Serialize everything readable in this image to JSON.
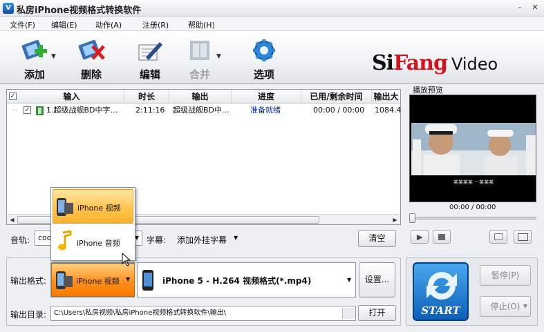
{
  "window": {
    "title": "私房iPhone视频格式转换软件",
    "app_icon": "V"
  },
  "menu": [
    "文件(F)",
    "编辑(E)",
    "动作(A)",
    "注册(R)",
    "帮助(H)"
  ],
  "toolbar": {
    "add": "添加",
    "delete": "删除",
    "edit": "编辑",
    "merge": "合并",
    "options": "选项"
  },
  "brand": {
    "part1": "Si",
    "part2": "Fang",
    "part3": "Video"
  },
  "file_list": {
    "columns": [
      "输入",
      "时长",
      "输出",
      "进度",
      "已用/剩余时间",
      "输出大"
    ],
    "rows": [
      {
        "input": "1.超级战舰BD中字...",
        "duration": "2:11:16",
        "output": "超级战舰BD中...",
        "progress": "准备就绪",
        "elapsed": "00:00 / 00:00",
        "size": "1084.4"
      }
    ]
  },
  "audio": {
    "label": "音轨:",
    "value": "coo"
  },
  "subtitle": {
    "label": "字幕:",
    "value": "添加外挂字幕"
  },
  "clear_button": "清空",
  "popup_menu": {
    "items": [
      "iPhone 视频",
      "iPhone 音频"
    ],
    "selected": 0
  },
  "output": {
    "format_label": "输出格式:",
    "format_category": "iPhone 视频",
    "format_value": "iPhone 5 - H.264 视频格式(*.mp4)",
    "settings_button": "设置...",
    "dir_label": "输出目录:",
    "dir_value": "C:\\Users\\私房视频\\私房iPhone视频格式转换软件\\输出\\",
    "open_button": "打开"
  },
  "preview": {
    "label": "播放预览",
    "time": "00:00 / 00:00",
    "caption": "某某某某 一某某某"
  },
  "controls": {
    "start": "START",
    "pause": "暂停(P)",
    "stop": "停止(O)"
  },
  "colors": {
    "accent_blue": "#0b5fb8",
    "brand_red": "#d3141c",
    "progress_text": "#0a2fd0",
    "orange": "#f57900"
  }
}
